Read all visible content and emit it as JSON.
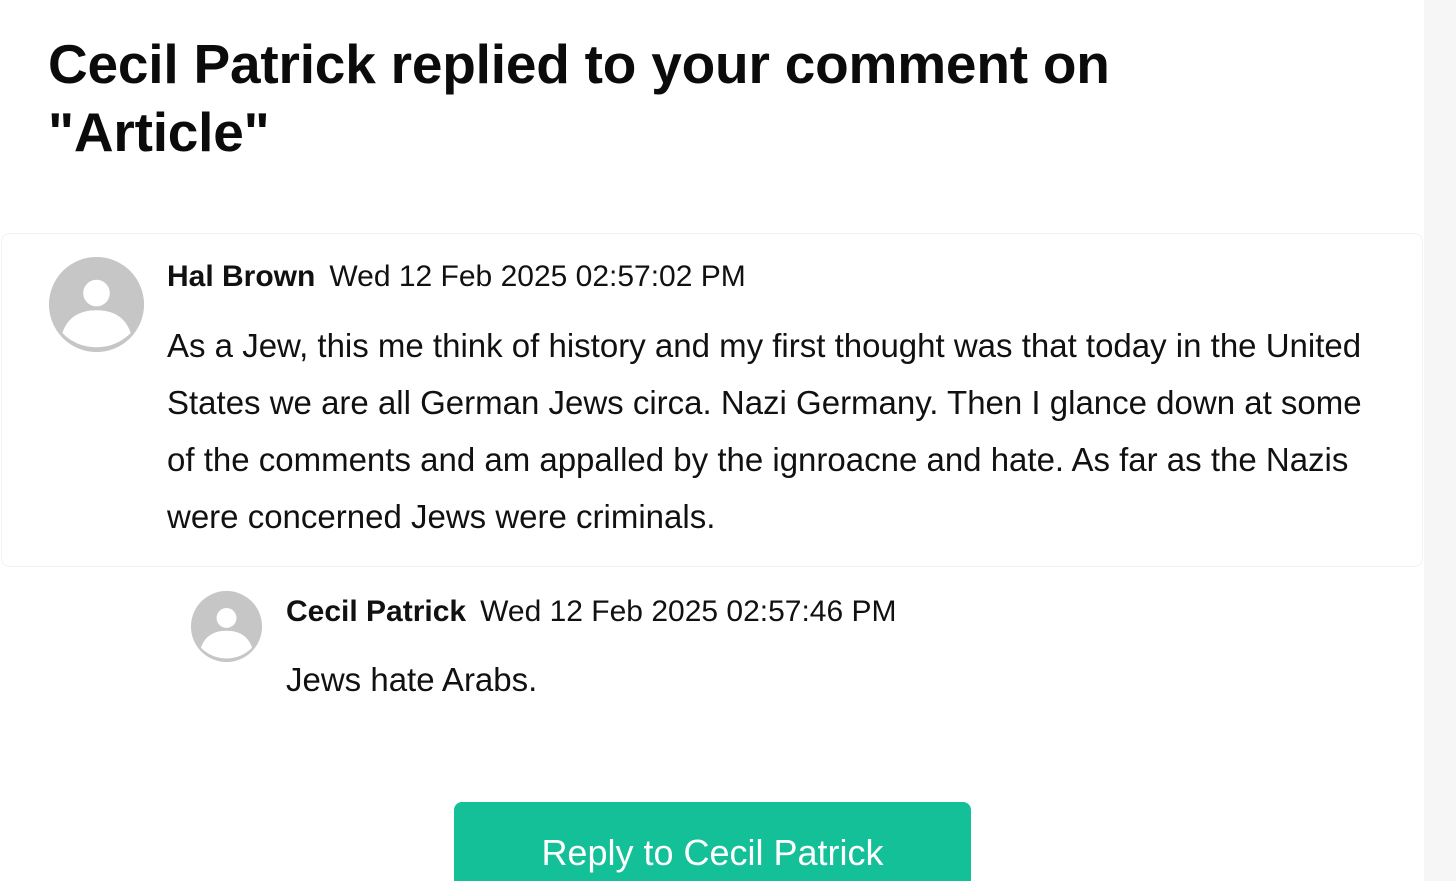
{
  "notification": {
    "title": "Cecil Patrick replied to your comment on \"Article\""
  },
  "parent_comment": {
    "author": "Hal Brown",
    "timestamp": "Wed 12 Feb 2025 02:57:02 PM",
    "text": "As a Jew, this me think of history and my first thought was that today in the United States we are all German Jews circa. Nazi Germany. Then I glance down at some of the comments and am appalled by the ignroacne and hate. As far as the Nazis were concerned Jews were criminals.",
    "avatar_icon": "default-user-icon"
  },
  "reply_comment": {
    "author": "Cecil Patrick",
    "timestamp": "Wed 12 Feb 2025 02:57:46 PM",
    "text": "Jews hate Arabs.",
    "avatar_icon": "default-user-icon"
  },
  "actions": {
    "reply_label": "Reply to Cecil Patrick"
  },
  "colors": {
    "accent": "#14c097",
    "avatar": "#c6c6c6",
    "text": "#111111",
    "background": "#ffffff"
  }
}
